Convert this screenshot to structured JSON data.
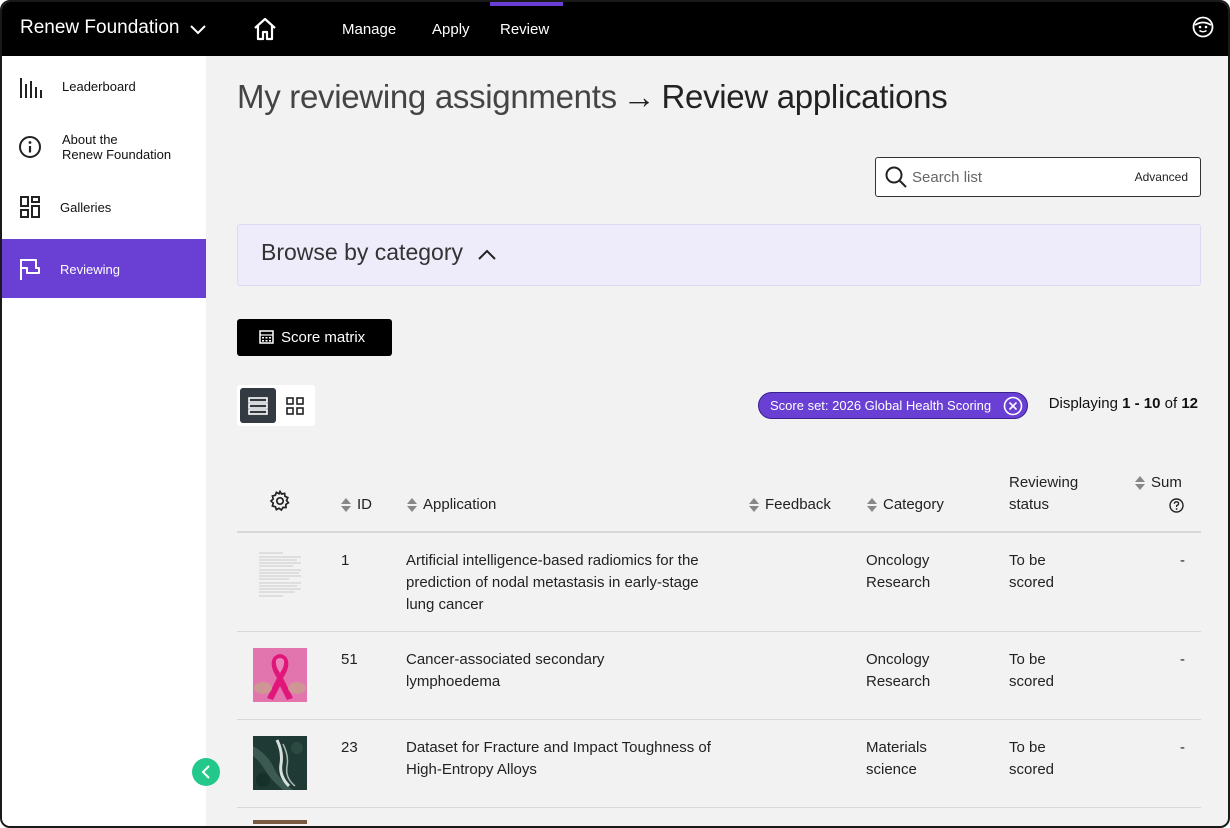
{
  "topbar": {
    "org_name": "Renew Foundation",
    "nav": [
      {
        "label": "Manage"
      },
      {
        "label": "Apply"
      },
      {
        "label": "Review"
      }
    ]
  },
  "sidebar": {
    "items": [
      {
        "label": "Leaderboard",
        "icon": "bar-chart-icon"
      },
      {
        "label": "About the\nRenew Foundation",
        "icon": "info-icon"
      },
      {
        "label": "Galleries",
        "icon": "gallery-icon"
      },
      {
        "label": "Reviewing",
        "icon": "flag-icon"
      }
    ]
  },
  "header": {
    "breadcrumb": "My reviewing assignments",
    "arrow": "→",
    "title": "Review applications"
  },
  "search": {
    "placeholder": "Search list",
    "advanced_label": "Advanced"
  },
  "browse": {
    "label": "Browse by category"
  },
  "score_matrix_label": "Score matrix",
  "filter_chip": "Score set: 2026 Global Health Scoring",
  "displaying": {
    "prefix": "Displaying",
    "range": "1 - 10",
    "of": "of",
    "total": "12"
  },
  "table": {
    "headers": {
      "id": "ID",
      "application": "Application",
      "feedback": "Feedback",
      "category": "Category",
      "status": "Reviewing\nstatus",
      "sum": "Sum"
    },
    "rows": [
      {
        "id": "1",
        "application": "Artificial intelligence-based radiomics for the prediction of nodal metastasis in early-stage lung cancer",
        "category": "Oncology Research",
        "status": "To be scored",
        "sum": "-",
        "thumb": "document"
      },
      {
        "id": "51",
        "application": "Cancer-associated secondary lymphoedema",
        "category": "Oncology Research",
        "status": "To be scored",
        "sum": "-",
        "thumb": "pink-ribbon"
      },
      {
        "id": "23",
        "application": "Dataset for Fracture and Impact Toughness of High-Entropy Alloys",
        "category": "Materials science",
        "status": "To be scored",
        "sum": "-",
        "thumb": "dark-aerial"
      }
    ]
  },
  "colors": {
    "accent": "#6a3fd4",
    "topbar": "#000000",
    "collapse": "#22c98a",
    "browse_bg": "#eeecfb"
  }
}
